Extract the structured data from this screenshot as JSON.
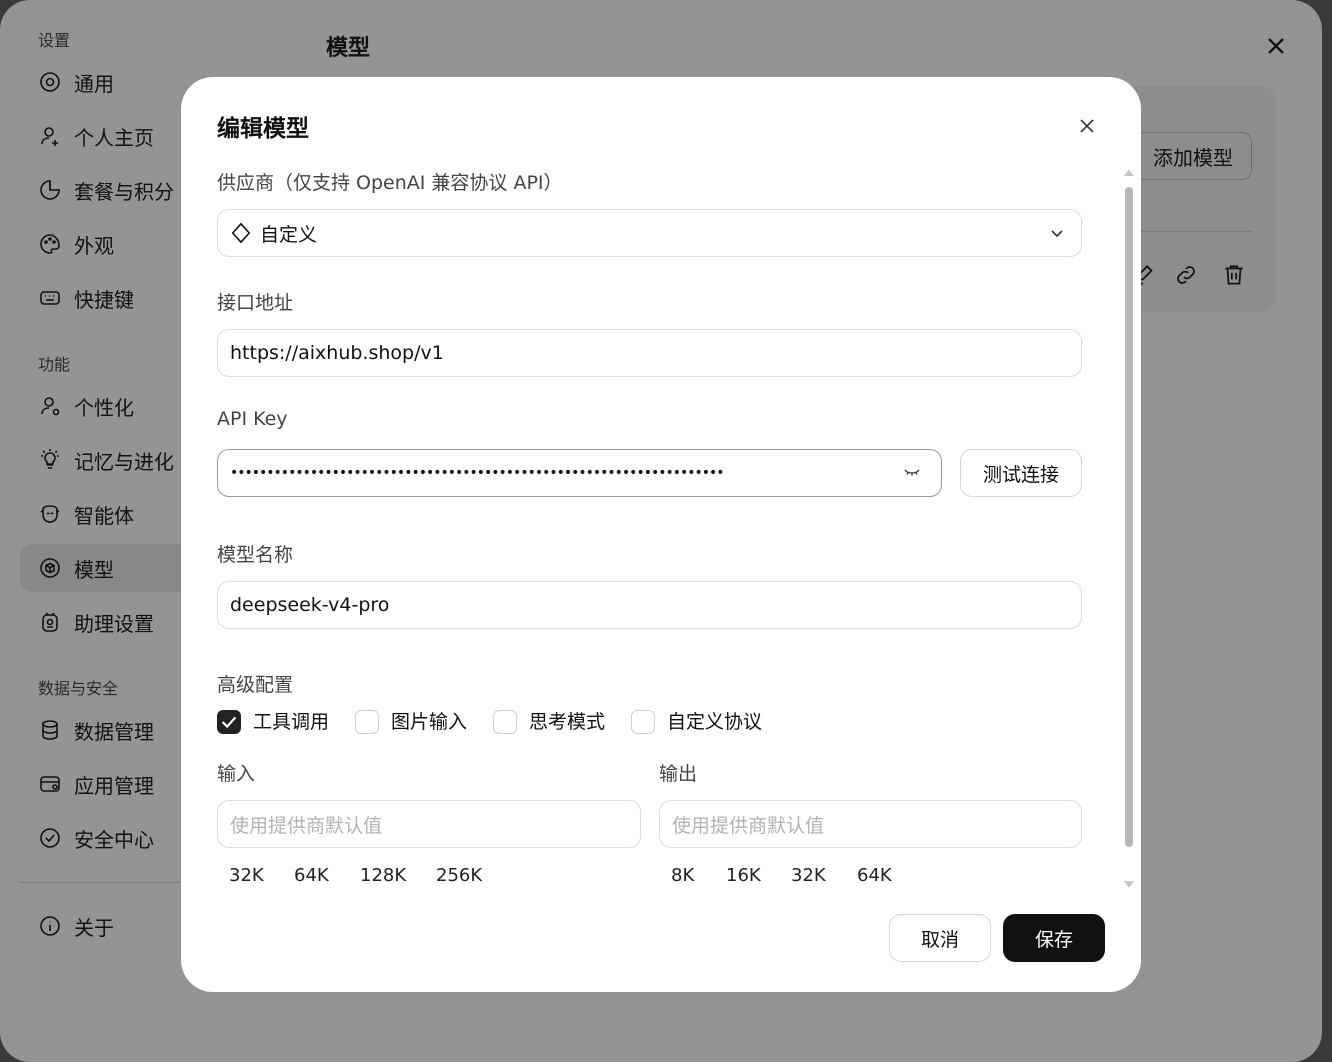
{
  "sidebar": {
    "sections": [
      {
        "title": "设置",
        "items": [
          "通用",
          "个人主页",
          "套餐与积分",
          "外观",
          "快捷键"
        ]
      },
      {
        "title": "功能",
        "items": [
          "个性化",
          "记忆与进化",
          "智能体",
          "模型",
          "助理设置"
        ]
      },
      {
        "title": "数据与安全",
        "items": [
          "数据管理",
          "应用管理",
          "安全中心"
        ]
      }
    ],
    "about": "关于",
    "active_item": "模型"
  },
  "page": {
    "title": "模型",
    "add_model_button": "添加模型"
  },
  "modal": {
    "title": "编辑模型",
    "provider_label": "供应商（仅支持 OpenAI 兼容协议 API）",
    "provider_value": "自定义",
    "endpoint_label": "接口地址",
    "endpoint_value": "https://aixhub.shop/v1",
    "apikey_label": "API Key",
    "apikey_masked": "••••••••••••••••••••••••••••••••••••••••••••••••••••••••••••••••••••",
    "test_button": "测试连接",
    "model_name_label": "模型名称",
    "model_name_value": "deepseek-v4-pro",
    "advanced_label": "高级配置",
    "options": [
      {
        "label": "工具调用",
        "checked": true
      },
      {
        "label": "图片输入",
        "checked": false
      },
      {
        "label": "思考模式",
        "checked": false
      },
      {
        "label": "自定义协议",
        "checked": false
      }
    ],
    "input_label": "输入",
    "output_label": "输出",
    "input_placeholder": "使用提供商默认值",
    "output_placeholder": "使用提供商默认值",
    "input_presets": [
      "32K",
      "64K",
      "128K",
      "256K"
    ],
    "output_presets": [
      "8K",
      "16K",
      "32K",
      "64K"
    ],
    "cancel_button": "取消",
    "save_button": "保存"
  }
}
